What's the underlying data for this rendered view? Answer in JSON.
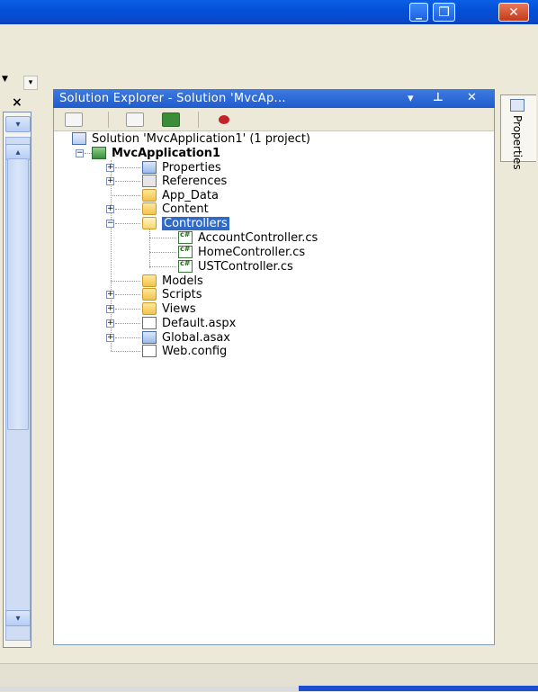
{
  "window": {
    "controls": {
      "minimize": "_",
      "maximize": "❐",
      "close": "✕"
    }
  },
  "left_panel": {
    "close": "×"
  },
  "solution_explorer": {
    "title": "Solution Explorer - Solution 'MvcAp...",
    "header_buttons": [
      "▾",
      "⊥",
      "✕"
    ],
    "toolbar_icons": [
      "properties-icon",
      "show-all-files-icon",
      "refresh-icon",
      "class-diagram-icon"
    ],
    "tree": [
      {
        "label": "Solution 'MvcApplication1' (1 project)",
        "icon": "solution-icon"
      },
      {
        "label": "MvcApplication1",
        "icon": "project-icon",
        "expanded": true,
        "bold": true
      },
      {
        "label": "Properties",
        "icon": "properties-folder-icon",
        "expander": "+"
      },
      {
        "label": "References",
        "icon": "references-icon",
        "expander": "+"
      },
      {
        "label": "App_Data",
        "icon": "folder-icon"
      },
      {
        "label": "Content",
        "icon": "folder-icon",
        "expander": "+"
      },
      {
        "label": "Controllers",
        "icon": "folder-open-icon",
        "expander": "−",
        "selected": true
      },
      {
        "label": "AccountController.cs",
        "icon": "cs-file-icon"
      },
      {
        "label": "HomeController.cs",
        "icon": "cs-file-icon"
      },
      {
        "label": "USTController.cs",
        "icon": "cs-file-icon"
      },
      {
        "label": "Models",
        "icon": "folder-icon"
      },
      {
        "label": "Scripts",
        "icon": "folder-icon",
        "expander": "+"
      },
      {
        "label": "Views",
        "icon": "folder-icon",
        "expander": "+"
      },
      {
        "label": "Default.aspx",
        "icon": "aspx-file-icon",
        "expander": "+"
      },
      {
        "label": "Global.asax",
        "icon": "asax-file-icon",
        "expander": "+"
      },
      {
        "label": "Web.config",
        "icon": "config-file-icon"
      }
    ]
  },
  "properties_tab": {
    "label": "Properties"
  },
  "colors": {
    "selection": "#316ac5",
    "title_blue": "#0a5fe6",
    "panel_border": "#7f9db9"
  }
}
